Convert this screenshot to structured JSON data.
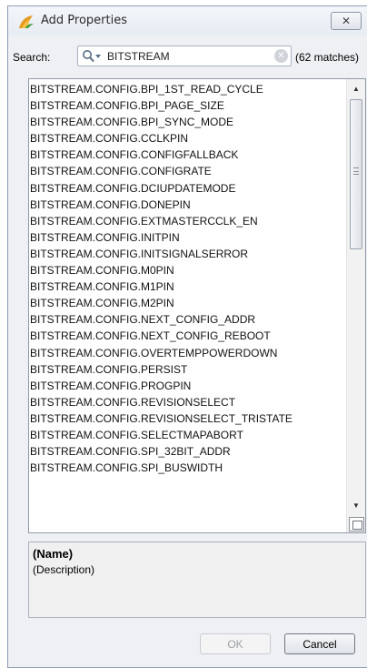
{
  "window": {
    "title": "Add Properties",
    "close_symbol": "✕",
    "icons": {
      "app": "vivado-leaf-icon",
      "close": "close-icon"
    }
  },
  "search": {
    "label": "Search:",
    "value": "BITSTREAM",
    "placeholder": "",
    "match_count": "(62 matches)",
    "clear_symbol": "✕",
    "icons": {
      "search": "search-dropdown-icon",
      "clear": "clear-icon"
    }
  },
  "list": {
    "items": [
      "BITSTREAM.CONFIG.BPI_1ST_READ_CYCLE",
      "BITSTREAM.CONFIG.BPI_PAGE_SIZE",
      "BITSTREAM.CONFIG.BPI_SYNC_MODE",
      "BITSTREAM.CONFIG.CCLKPIN",
      "BITSTREAM.CONFIG.CONFIGFALLBACK",
      "BITSTREAM.CONFIG.CONFIGRATE",
      "BITSTREAM.CONFIG.DCIUPDATEMODE",
      "BITSTREAM.CONFIG.DONEPIN",
      "BITSTREAM.CONFIG.EXTMASTERCCLK_EN",
      "BITSTREAM.CONFIG.INITPIN",
      "BITSTREAM.CONFIG.INITSIGNALSERROR",
      "BITSTREAM.CONFIG.M0PIN",
      "BITSTREAM.CONFIG.M1PIN",
      "BITSTREAM.CONFIG.M2PIN",
      "BITSTREAM.CONFIG.NEXT_CONFIG_ADDR",
      "BITSTREAM.CONFIG.NEXT_CONFIG_REBOOT",
      "BITSTREAM.CONFIG.OVERTEMPPOWERDOWN",
      "BITSTREAM.CONFIG.PERSIST",
      "BITSTREAM.CONFIG.PROGPIN",
      "BITSTREAM.CONFIG.REVISIONSELECT",
      "BITSTREAM.CONFIG.REVISIONSELECT_TRISTATE",
      "BITSTREAM.CONFIG.SELECTMAPABORT",
      "BITSTREAM.CONFIG.SPI_32BIT_ADDR",
      "BITSTREAM.CONFIG.SPI_BUSWIDTH"
    ],
    "scroll": {
      "up_arrow": "▲",
      "down_arrow": "▼",
      "grip_icon": "scroll-grip-icon"
    }
  },
  "description": {
    "name": "(Name)",
    "text": "(Description)"
  },
  "buttons": {
    "ok": "OK",
    "ok_enabled": false,
    "cancel": "Cancel"
  },
  "colors": {
    "window_bg": "#eef0f4",
    "list_bg": "#ffffff",
    "disabled_text": "#9b9ea3"
  }
}
